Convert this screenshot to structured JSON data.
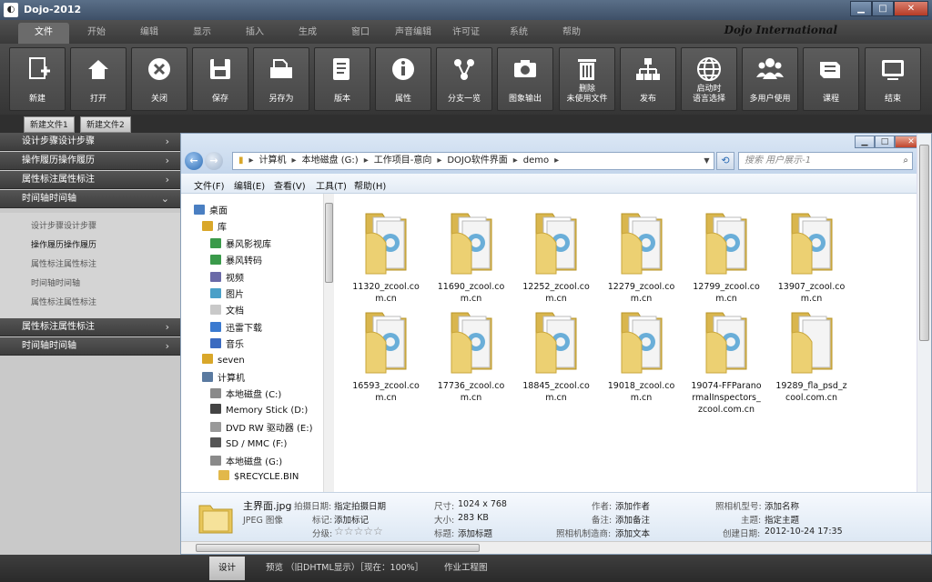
{
  "window": {
    "title": "Dojo-2012",
    "min": "▁",
    "max": "□",
    "close": "✕"
  },
  "menu": {
    "tabs": [
      "文件",
      "开始",
      "编辑",
      "显示",
      "插入",
      "生成",
      "窗口",
      "声音编辑",
      "许可证",
      "系统",
      "帮助"
    ],
    "active_index": 0,
    "brand": "Dojo International"
  },
  "toolbar": [
    {
      "icon": "new-file-icon",
      "label": "新建"
    },
    {
      "icon": "open-icon",
      "label": "打开"
    },
    {
      "icon": "close-circle-icon",
      "label": "关闭"
    },
    {
      "icon": "save-disk-icon",
      "label": "保存"
    },
    {
      "icon": "save-as-icon",
      "label": "另存为"
    },
    {
      "icon": "version-icon",
      "label": "版本"
    },
    {
      "icon": "info-icon",
      "label": "属性"
    },
    {
      "icon": "branch-icon",
      "label": "分支一览"
    },
    {
      "icon": "camera-icon",
      "label": "图象输出"
    },
    {
      "icon": "trash-icon",
      "label": "删除\n未使用文件"
    },
    {
      "icon": "publish-icon",
      "label": "发布"
    },
    {
      "icon": "globe-icon",
      "label": "启动时\n语言选择"
    },
    {
      "icon": "users-icon",
      "label": "多用户使用"
    },
    {
      "icon": "course-icon",
      "label": "课程"
    },
    {
      "icon": "exit-icon",
      "label": "结束"
    }
  ],
  "doc_tabs": [
    "新建文件1",
    "新建文件2"
  ],
  "left_panel": {
    "sections": [
      {
        "label": "设计步骤设计步骤",
        "expanded": false
      },
      {
        "label": "操作履历操作履历",
        "expanded": false
      },
      {
        "label": "属性标注属性标注",
        "expanded": false
      },
      {
        "label": "时间轴时间轴",
        "expanded": true
      }
    ],
    "sub_items": [
      "设计步骤设计步骤",
      "操作履历操作履历",
      "属性标注属性标注",
      "时间轴时间轴",
      "属性标注属性标注"
    ],
    "sub_active_index": 1,
    "bottom_sections": [
      "属性标注属性标注",
      "时间轴时间轴"
    ]
  },
  "explorer": {
    "address": [
      "计算机",
      "本地磁盘 (G:)",
      "工作项目-意向",
      "DOJO软件界面",
      "demo"
    ],
    "search_placeholder": "搜索 用户展示-1",
    "menus": [
      "文件(F)",
      "编辑(E)",
      "查看(V)",
      "工具(T)",
      "帮助(H)"
    ],
    "nav": [
      {
        "label": "桌面",
        "icon": "desktop-icon",
        "indent": 0
      },
      {
        "label": "库",
        "icon": "library-icon",
        "indent": 1
      },
      {
        "label": "暴风影视库",
        "icon": "video-lib-icon",
        "indent": 2
      },
      {
        "label": "暴风转码",
        "icon": "transcode-icon",
        "indent": 2
      },
      {
        "label": "视频",
        "icon": "video-icon",
        "indent": 2
      },
      {
        "label": "图片",
        "icon": "pictures-icon",
        "indent": 2
      },
      {
        "label": "文档",
        "icon": "documents-icon",
        "indent": 2
      },
      {
        "label": "迅雷下载",
        "icon": "download-icon",
        "indent": 2
      },
      {
        "label": "音乐",
        "icon": "music-icon",
        "indent": 2
      },
      {
        "label": "seven",
        "icon": "user-folder-icon",
        "indent": 1
      },
      {
        "label": "计算机",
        "icon": "computer-icon",
        "indent": 1
      },
      {
        "label": "本地磁盘 (C:)",
        "icon": "drive-icon",
        "indent": 2
      },
      {
        "label": "Memory Stick (D:)",
        "icon": "memory-stick-icon",
        "indent": 2
      },
      {
        "label": "DVD RW 驱动器 (E:)",
        "icon": "dvd-icon",
        "indent": 2
      },
      {
        "label": "SD / MMC (F:)",
        "icon": "sd-card-icon",
        "indent": 2
      },
      {
        "label": "本地磁盘 (G:)",
        "icon": "drive-icon",
        "indent": 2
      },
      {
        "label": "$RECYCLE.BIN",
        "icon": "folder-icon",
        "indent": 3
      }
    ],
    "folders": [
      "11320_zcool.com.cn",
      "11690_zcool.com.cn",
      "12252_zcool.com.cn",
      "12279_zcool.com.cn",
      "12799_zcool.com.cn",
      "13907_zcool.com.cn",
      "16593_zcool.com.cn",
      "17736_zcool.com.cn",
      "18845_zcool.com.cn",
      "19018_zcool.com.cn",
      "19074-FFParanormalInspectors_zcool.com.cn",
      "19289_fla_psd_zcool.com.cn"
    ],
    "folder_lines": [
      [
        "11320_zcool.co",
        "m.cn"
      ],
      [
        "11690_zcool.co",
        "m.cn"
      ],
      [
        "12252_zcool.co",
        "m.cn"
      ],
      [
        "12279_zcool.co",
        "m.cn"
      ],
      [
        "12799_zcool.co",
        "m.cn"
      ],
      [
        "13907_zcool.co",
        "m.cn"
      ],
      [
        "16593_zcool.co",
        "m.cn"
      ],
      [
        "17736_zcool.co",
        "m.cn"
      ],
      [
        "18845_zcool.co",
        "m.cn"
      ],
      [
        "19018_zcool.co",
        "m.cn"
      ],
      [
        "19074-FFParano",
        "rmalInspectors_",
        "zcool.com.cn"
      ],
      [
        "19289_fla_psd_z",
        "cool.com.cn"
      ]
    ],
    "details": {
      "filename": "主界面.jpg",
      "filetype": "JPEG 图像",
      "shot_date_label": "拍摄日期:",
      "shot_date": "指定拍摄日期",
      "tags_label": "标记:",
      "tags": "添加标记",
      "rating_label": "分级:",
      "rating": "☆☆☆☆☆",
      "dims_label": "尺寸:",
      "dims": "1024 x 768",
      "size_label": "大小:",
      "size": "283 KB",
      "title_label": "标题:",
      "title": "添加标题",
      "author_label": "作者:",
      "author": "添加作者",
      "notes_label": "备注:",
      "notes": "添加备注",
      "maker_label": "照相机制造商:",
      "maker": "添加文本",
      "model_label": "照相机型号:",
      "model": "添加名称",
      "subject_label": "主题:",
      "subject": "指定主题",
      "created_label": "创建日期:",
      "created": "2012-10-24 17:35"
    }
  },
  "statusbar": {
    "items": [
      "设计",
      "预览 （旧DHTML显示）［现在：100%］",
      "作业工程图"
    ],
    "active_index": 0
  }
}
